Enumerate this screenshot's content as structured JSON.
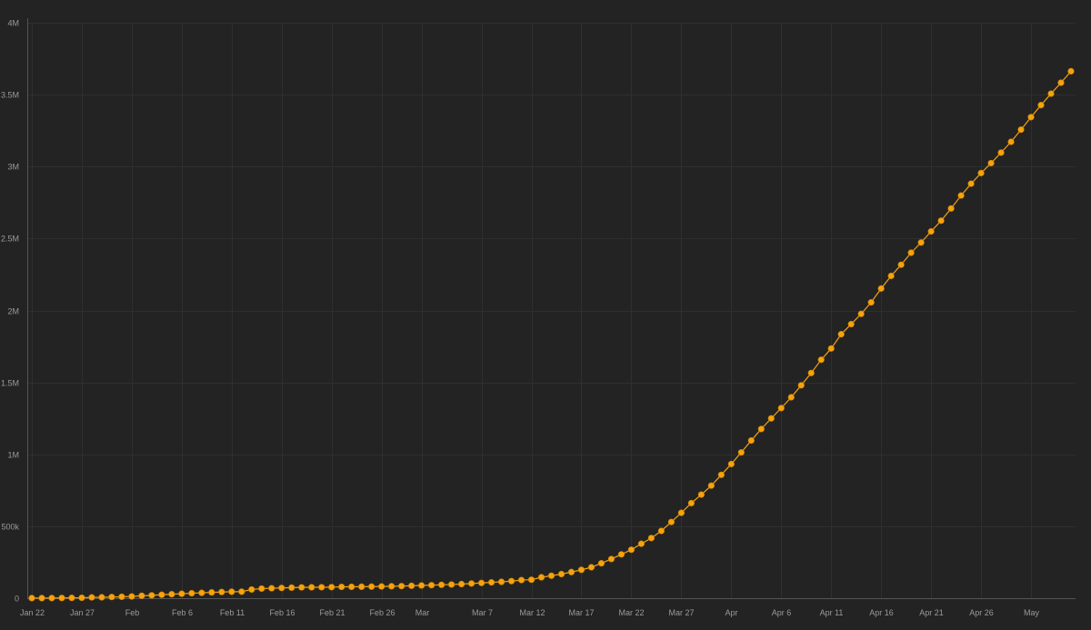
{
  "chart_data": {
    "type": "line",
    "title": "",
    "xlabel": "",
    "ylabel": "",
    "grid": true,
    "legend": "none",
    "color": "#f5a30f",
    "ylim": [
      0,
      4000000
    ],
    "y_ticks": [
      {
        "value": 0,
        "label": "0"
      },
      {
        "value": 500000,
        "label": "500k"
      },
      {
        "value": 1000000,
        "label": "1M"
      },
      {
        "value": 1500000,
        "label": "1.5M"
      },
      {
        "value": 2000000,
        "label": "2M"
      },
      {
        "value": 2500000,
        "label": "2.5M"
      },
      {
        "value": 3000000,
        "label": "3M"
      },
      {
        "value": 3500000,
        "label": "3.5M"
      },
      {
        "value": 4000000,
        "label": "4M"
      }
    ],
    "x_ticks": [
      {
        "date": "2020-01-22",
        "label": "Jan 22"
      },
      {
        "date": "2020-01-27",
        "label": "Jan 27"
      },
      {
        "date": "2020-02-01",
        "label": "Feb"
      },
      {
        "date": "2020-02-06",
        "label": "Feb 6"
      },
      {
        "date": "2020-02-11",
        "label": "Feb 11"
      },
      {
        "date": "2020-02-16",
        "label": "Feb 16"
      },
      {
        "date": "2020-02-21",
        "label": "Feb 21"
      },
      {
        "date": "2020-02-26",
        "label": "Feb 26"
      },
      {
        "date": "2020-03-01",
        "label": "Mar"
      },
      {
        "date": "2020-03-07",
        "label": "Mar 7"
      },
      {
        "date": "2020-03-12",
        "label": "Mar 12"
      },
      {
        "date": "2020-03-17",
        "label": "Mar 17"
      },
      {
        "date": "2020-03-22",
        "label": "Mar 22"
      },
      {
        "date": "2020-03-27",
        "label": "Mar 27"
      },
      {
        "date": "2020-04-01",
        "label": "Apr"
      },
      {
        "date": "2020-04-06",
        "label": "Apr 6"
      },
      {
        "date": "2020-04-11",
        "label": "Apr 11"
      },
      {
        "date": "2020-04-16",
        "label": "Apr 16"
      },
      {
        "date": "2020-04-21",
        "label": "Apr 21"
      },
      {
        "date": "2020-04-26",
        "label": "Apr 26"
      },
      {
        "date": "2020-05-01",
        "label": "May"
      }
    ],
    "x": [
      "2020-01-22",
      "2020-01-23",
      "2020-01-24",
      "2020-01-25",
      "2020-01-26",
      "2020-01-27",
      "2020-01-28",
      "2020-01-29",
      "2020-01-30",
      "2020-01-31",
      "2020-02-01",
      "2020-02-02",
      "2020-02-03",
      "2020-02-04",
      "2020-02-05",
      "2020-02-06",
      "2020-02-07",
      "2020-02-08",
      "2020-02-09",
      "2020-02-10",
      "2020-02-11",
      "2020-02-12",
      "2020-02-13",
      "2020-02-14",
      "2020-02-15",
      "2020-02-16",
      "2020-02-17",
      "2020-02-18",
      "2020-02-19",
      "2020-02-20",
      "2020-02-21",
      "2020-02-22",
      "2020-02-23",
      "2020-02-24",
      "2020-02-25",
      "2020-02-26",
      "2020-02-27",
      "2020-02-28",
      "2020-02-29",
      "2020-03-01",
      "2020-03-02",
      "2020-03-03",
      "2020-03-04",
      "2020-03-05",
      "2020-03-06",
      "2020-03-07",
      "2020-03-08",
      "2020-03-09",
      "2020-03-10",
      "2020-03-11",
      "2020-03-12",
      "2020-03-13",
      "2020-03-14",
      "2020-03-15",
      "2020-03-16",
      "2020-03-17",
      "2020-03-18",
      "2020-03-19",
      "2020-03-20",
      "2020-03-21",
      "2020-03-22",
      "2020-03-23",
      "2020-03-24",
      "2020-03-25",
      "2020-03-26",
      "2020-03-27",
      "2020-03-28",
      "2020-03-29",
      "2020-03-30",
      "2020-03-31",
      "2020-04-01",
      "2020-04-02",
      "2020-04-03",
      "2020-04-04",
      "2020-04-05",
      "2020-04-06",
      "2020-04-07",
      "2020-04-08",
      "2020-04-09",
      "2020-04-10",
      "2020-04-11",
      "2020-04-12",
      "2020-04-13",
      "2020-04-14",
      "2020-04-15",
      "2020-04-16",
      "2020-04-17",
      "2020-04-18",
      "2020-04-19",
      "2020-04-20",
      "2020-04-21",
      "2020-04-22",
      "2020-04-23",
      "2020-04-24",
      "2020-04-25",
      "2020-04-26",
      "2020-04-27",
      "2020-04-28",
      "2020-04-29",
      "2020-04-30",
      "2020-05-01",
      "2020-05-02",
      "2020-05-03",
      "2020-05-04",
      "2020-05-05"
    ],
    "values": [
      555,
      654,
      941,
      1434,
      2118,
      2927,
      5578,
      6166,
      8234,
      9927,
      12038,
      16787,
      19881,
      23892,
      27635,
      30817,
      34391,
      37120,
      40150,
      42762,
      44802,
      45221,
      60368,
      66885,
      69030,
      71224,
      73258,
      75136,
      75639,
      76197,
      76819,
      78572,
      78958,
      79561,
      80406,
      81388,
      82746,
      84112,
      86011,
      88369,
      90306,
      92840,
      95120,
      97886,
      101801,
      105847,
      109821,
      113590,
      118620,
      125875,
      128352,
      145205,
      156101,
      167454,
      181574,
      197102,
      214821,
      242570,
      272208,
      304507,
      336953,
      378235,
      418045,
      467653,
      529591,
      593291,
      660706,
      720117,
      782365,
      857487,
      932605,
      1013157,
      1095917,
      1176060,
      1249754,
      1321481,
      1396476,
      1479804,
      1565278,
      1657526,
      1735650,
      1834721,
      1904838,
      1976191,
      2056054,
      2152437,
      2240190,
      2317758,
      2401378,
      2472259,
      2549294,
      2624074,
      2708885,
      2798949,
      2881140,
      2955033,
      3024059,
      3097229,
      3172287,
      3256846,
      3343777,
      3427343,
      3506729,
      3583055,
      3662691
    ]
  }
}
